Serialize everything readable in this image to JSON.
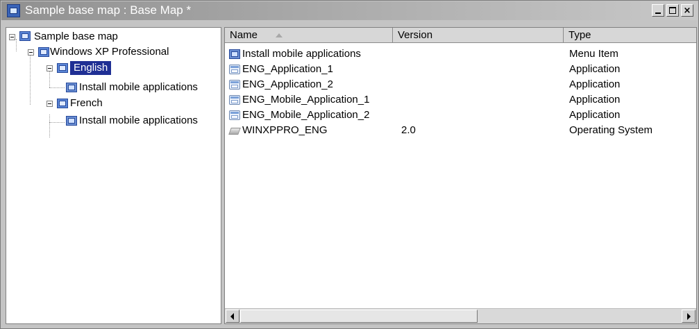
{
  "window": {
    "title": "Sample base map : Base Map *"
  },
  "tree": {
    "root": {
      "label": "Sample base map",
      "icon": "base-map-icon"
    },
    "os": {
      "label": "Windows XP Professional",
      "icon": "operating-system-icon"
    },
    "english": {
      "label": "English",
      "icon": "language-icon",
      "selected": true
    },
    "english_child": {
      "label": "Install mobile applications",
      "icon": "menu-item-icon"
    },
    "french": {
      "label": "French",
      "icon": "language-icon"
    },
    "french_child": {
      "label": "Install mobile applications",
      "icon": "menu-item-icon"
    }
  },
  "list": {
    "columns": [
      "Name",
      "Version",
      "Type"
    ],
    "sorted_by": "Name",
    "rows": [
      {
        "name": "Install mobile applications",
        "version": "",
        "type": "Menu Item",
        "icon": "menu-item-icon"
      },
      {
        "name": "ENG_Application_1",
        "version": "",
        "type": "Application",
        "icon": "application-icon"
      },
      {
        "name": "ENG_Application_2",
        "version": "",
        "type": "Application",
        "icon": "application-icon"
      },
      {
        "name": "ENG_Mobile_Application_1",
        "version": "",
        "type": "Application",
        "icon": "application-icon"
      },
      {
        "name": "ENG_Mobile_Application_2",
        "version": "",
        "type": "Application",
        "icon": "application-icon"
      },
      {
        "name": "WINXPPRO_ENG",
        "version": "2.0",
        "type": "Operating System",
        "icon": "os-image-icon"
      }
    ]
  },
  "colors": {
    "selection": "#1f2f94",
    "titlebar_start": "#909090",
    "titlebar_end": "#c8c8c8"
  }
}
